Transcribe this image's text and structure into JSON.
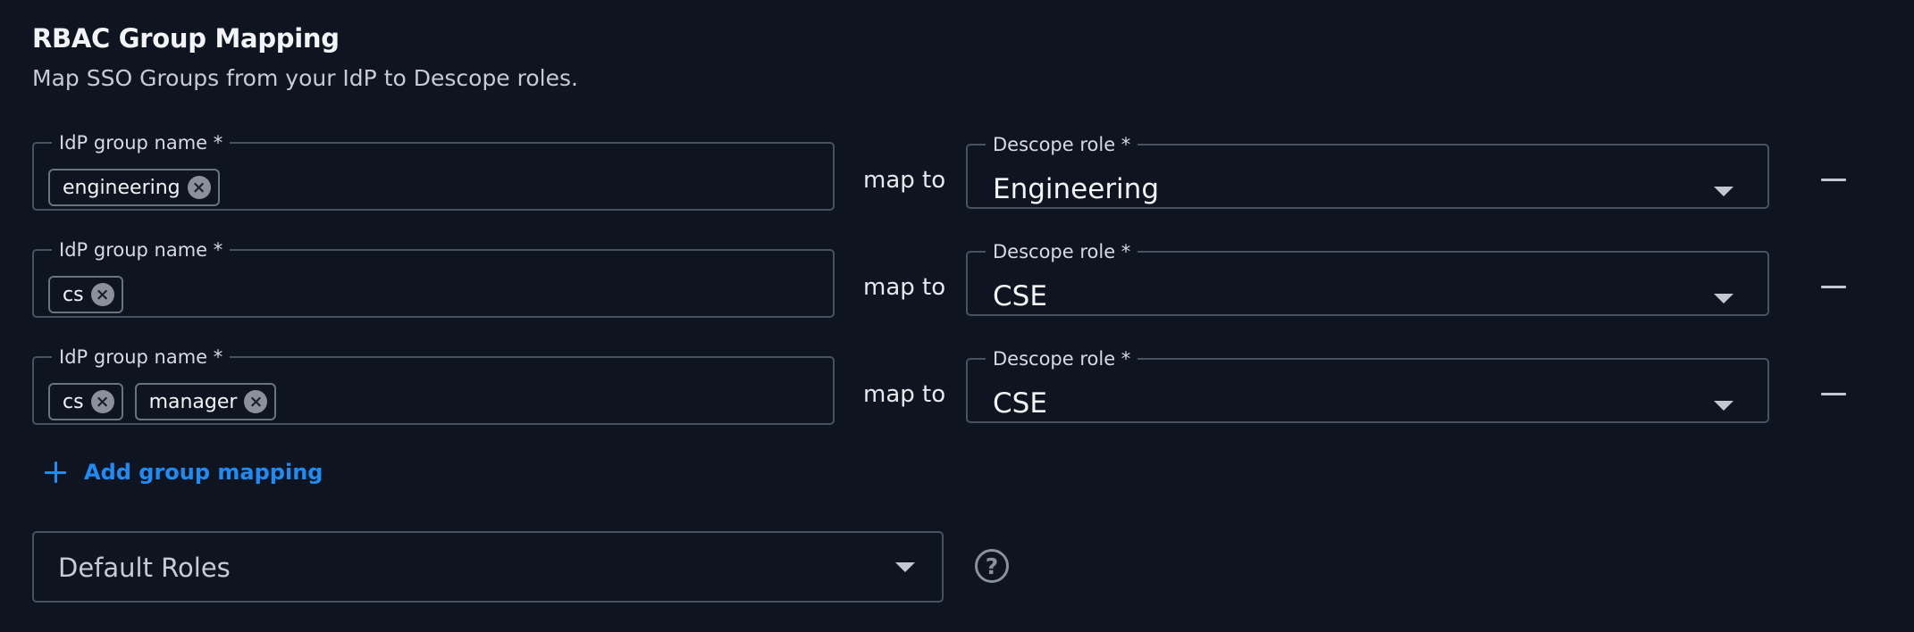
{
  "section": {
    "title": "RBAC Group Mapping",
    "subtitle": "Map SSO Groups from your IdP to Descope roles."
  },
  "mappings": [
    {
      "idp_label": "IdP group name *",
      "groups": [
        "engineering"
      ],
      "map_to": "map to",
      "role_label": "Descope role *",
      "role": "Engineering"
    },
    {
      "idp_label": "IdP group name *",
      "groups": [
        "cs"
      ],
      "map_to": "map to",
      "role_label": "Descope role *",
      "role": "CSE"
    },
    {
      "idp_label": "IdP group name *",
      "groups": [
        "cs",
        "manager"
      ],
      "map_to": "map to",
      "role_label": "Descope role *",
      "role": "CSE"
    }
  ],
  "add_mapping": {
    "label": "Add group mapping",
    "icon": "plus-icon"
  },
  "default_roles": {
    "placeholder": "Default Roles",
    "help_icon": "help-circle-icon",
    "help_glyph": "?"
  },
  "colors": {
    "background": "#0e1420",
    "accent": "#1e8cf4",
    "border": "#4a5160"
  }
}
